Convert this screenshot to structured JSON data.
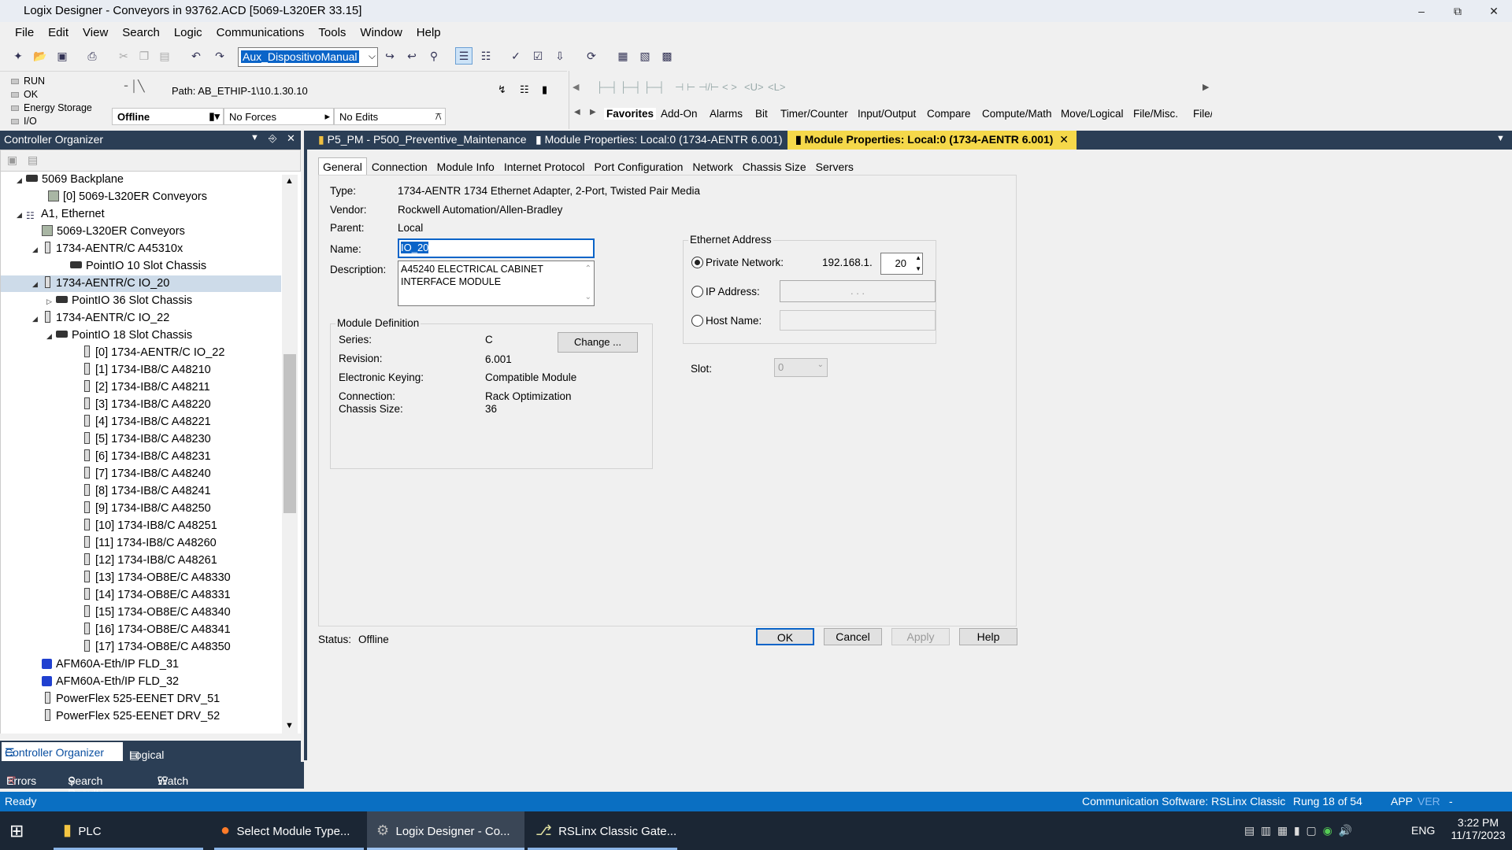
{
  "window": {
    "title": "Logix Designer - Conveyors in 93762.ACD [5069-L320ER 33.15]"
  },
  "menu": [
    "File",
    "Edit",
    "View",
    "Search",
    "Logic",
    "Communications",
    "Tools",
    "Window",
    "Help"
  ],
  "toolbar": {
    "combo_value": "Aux_DispositivoManual"
  },
  "status_panel": {
    "indicators": [
      "RUN",
      "OK",
      "Energy Storage",
      "I/O"
    ],
    "path_label": "Path: AB_ETHIP-1\\10.1.30.10",
    "mode": "Offline",
    "forces": "No Forces",
    "edits": "No Edits"
  },
  "ladder_tabs": [
    "Favorites",
    "Add-On",
    "Alarms",
    "Bit",
    "Timer/Counter",
    "Input/Output",
    "Compare",
    "Compute/Math",
    "Move/Logical",
    "File/Misc.",
    "File/"
  ],
  "organizer": {
    "title": "Controller Organizer",
    "tree": [
      {
        "text": "5069 Backplane",
        "icon": "chassis",
        "exp": "open"
      },
      {
        "text": "[0] 5069-L320ER Conveyors",
        "icon": "controller",
        "exp": ""
      },
      {
        "text": "A1, Ethernet",
        "icon": "network",
        "exp": "open"
      },
      {
        "text": "5069-L320ER Conveyors",
        "icon": "controller",
        "exp": ""
      },
      {
        "text": "1734-AENTR/C A45310x",
        "icon": "module",
        "exp": "open"
      },
      {
        "text": "PointIO 10 Slot Chassis",
        "icon": "chassis",
        "exp": ""
      },
      {
        "text": "1734-AENTR/C IO_20",
        "icon": "module",
        "exp": "open",
        "selected": true
      },
      {
        "text": "PointIO 36 Slot Chassis",
        "icon": "chassis",
        "exp": "closed"
      },
      {
        "text": "1734-AENTR/C IO_22",
        "icon": "module",
        "exp": "open"
      },
      {
        "text": "PointIO 18 Slot Chassis",
        "icon": "chassis",
        "exp": "open"
      },
      {
        "text": "[0] 1734-AENTR/C IO_22",
        "icon": "module",
        "exp": ""
      },
      {
        "text": "[1] 1734-IB8/C A48210",
        "icon": "module",
        "exp": ""
      },
      {
        "text": "[2] 1734-IB8/C A48211",
        "icon": "module",
        "exp": ""
      },
      {
        "text": "[3] 1734-IB8/C A48220",
        "icon": "module",
        "exp": ""
      },
      {
        "text": "[4] 1734-IB8/C A48221",
        "icon": "module",
        "exp": ""
      },
      {
        "text": "[5] 1734-IB8/C A48230",
        "icon": "module",
        "exp": ""
      },
      {
        "text": "[6] 1734-IB8/C A48231",
        "icon": "module",
        "exp": ""
      },
      {
        "text": "[7] 1734-IB8/C A48240",
        "icon": "module",
        "exp": ""
      },
      {
        "text": "[8] 1734-IB8/C A48241",
        "icon": "module",
        "exp": ""
      },
      {
        "text": "[9] 1734-IB8/C A48250",
        "icon": "module",
        "exp": ""
      },
      {
        "text": "[10] 1734-IB8/C A48251",
        "icon": "module",
        "exp": ""
      },
      {
        "text": "[11] 1734-IB8/C A48260",
        "icon": "module",
        "exp": ""
      },
      {
        "text": "[12] 1734-IB8/C A48261",
        "icon": "module",
        "exp": ""
      },
      {
        "text": "[13] 1734-OB8E/C A48330",
        "icon": "module",
        "exp": ""
      },
      {
        "text": "[14] 1734-OB8E/C A48331",
        "icon": "module",
        "exp": ""
      },
      {
        "text": "[15] 1734-OB8E/C A48340",
        "icon": "module",
        "exp": ""
      },
      {
        "text": "[16] 1734-OB8E/C A48341",
        "icon": "module",
        "exp": ""
      },
      {
        "text": "[17] 1734-OB8E/C A48350",
        "icon": "module",
        "exp": ""
      },
      {
        "text": "AFM60A-Eth/IP FLD_31",
        "icon": "drive",
        "exp": ""
      },
      {
        "text": "AFM60A-Eth/IP FLD_32",
        "icon": "drive",
        "exp": ""
      },
      {
        "text": "PowerFlex 525-EENET DRV_51",
        "icon": "module",
        "exp": ""
      },
      {
        "text": "PowerFlex 525-EENET DRV_52",
        "icon": "module",
        "exp": ""
      }
    ],
    "bottom_tabs": [
      "Controller Organizer",
      "Logical Organizer"
    ],
    "bottom_panes": [
      "Errors",
      "Search Results",
      "Watch"
    ]
  },
  "doc_tabs": [
    {
      "label": "P5_PM - P500_Preventive_Maintenance",
      "active": false
    },
    {
      "label": "Module Properties: Local:0 (1734-AENTR 6.001)",
      "active": false
    },
    {
      "label": "Module Properties: Local:0 (1734-AENTR 6.001)",
      "active": true
    }
  ],
  "dialog": {
    "tabs": [
      "General",
      "Connection",
      "Module Info",
      "Internet Protocol",
      "Port Configuration",
      "Network",
      "Chassis Size",
      "Servers"
    ],
    "type_label": "Type:",
    "type_value": "1734-AENTR 1734 Ethernet Adapter, 2-Port, Twisted Pair Media",
    "vendor_label": "Vendor:",
    "vendor_value": "Rockwell Automation/Allen-Bradley",
    "parent_label": "Parent:",
    "parent_value": "Local",
    "name_label": "Name:",
    "name_value": "IO_20",
    "description_label": "Description:",
    "description_value": "A45240 ELECTRICAL CABINET INTERFACE MODULE",
    "module_definition": {
      "title": "Module Definition",
      "series_label": "Series:",
      "series": "C",
      "revision_label": "Revision:",
      "revision": "6.001",
      "keying_label": "Electronic Keying:",
      "keying": "Compatible Module",
      "connection_label": "Connection:",
      "connection": "Rack Optimization",
      "chassis_label": "Chassis Size:",
      "chassis": "36",
      "change_button": "Change ..."
    },
    "ethernet": {
      "title": "Ethernet Address",
      "private_label": "Private Network:",
      "private_prefix": "192.168.1.",
      "private_value": "20",
      "ip_label": "IP Address:",
      "ip_placeholder": ".   .   .",
      "host_label": "Host Name:",
      "selected": "private"
    },
    "slot_label": "Slot:",
    "slot_value": "0",
    "status_label": "Status:",
    "status_value": "Offline",
    "buttons": {
      "ok": "OK",
      "cancel": "Cancel",
      "apply": "Apply",
      "help": "Help"
    }
  },
  "statusbar": {
    "left": "Ready",
    "comm": "Communication Software: RSLinx Classic",
    "rung": "Rung 18 of 54",
    "app": "APP",
    "ver": "VER",
    "dash": "-"
  },
  "taskbar": {
    "items": [
      {
        "label": "PLC",
        "icon": "folder-icon"
      },
      {
        "label": "Select Module Type...",
        "icon": "firefox-icon"
      },
      {
        "label": "Logix Designer - Co...",
        "icon": "logix-icon",
        "active": true
      },
      {
        "label": "RSLinx Classic Gate...",
        "icon": "rslinx-icon"
      }
    ],
    "lang": "ENG",
    "time": "3:22 PM",
    "date": "11/17/2023"
  },
  "colors": {
    "accent": "#0a6fc2",
    "panel_dark": "#2b3e55",
    "active_tab": "#f5d84a",
    "selection": "#0a64c8"
  }
}
